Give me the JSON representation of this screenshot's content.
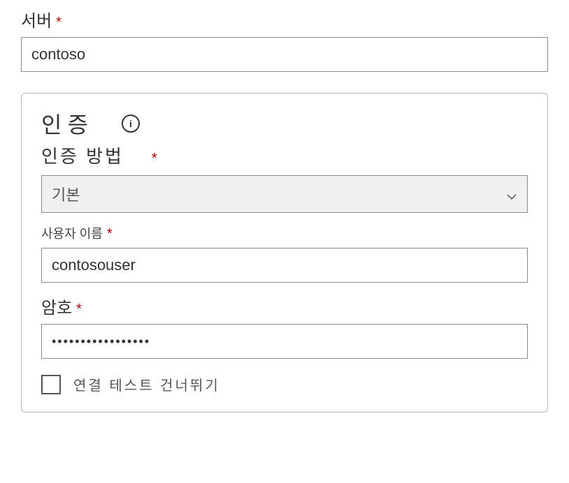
{
  "server": {
    "label": "서버",
    "required": "*",
    "value": "contoso"
  },
  "auth": {
    "title": "인증",
    "info_icon": "i",
    "method": {
      "label": "인증 방법",
      "required": "*",
      "value": "기본"
    },
    "username": {
      "label": "사용자 이름",
      "required": "*",
      "value": "contosouser"
    },
    "password": {
      "label": "암호",
      "required": "*",
      "masked": "•••••••••••••••••"
    },
    "skip_test": {
      "label": "연결 테스트 건너뛰기",
      "checked": false
    }
  }
}
